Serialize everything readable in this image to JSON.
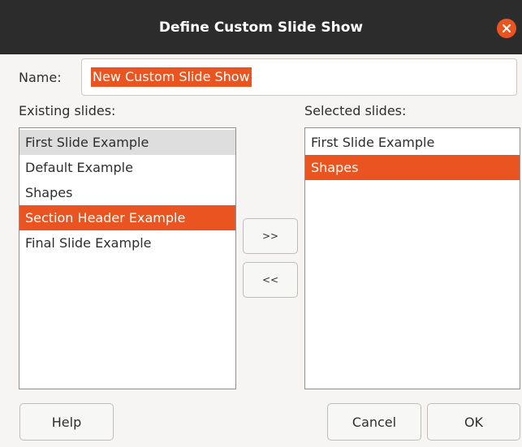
{
  "window": {
    "title": "Define Custom Slide Show",
    "close_icon": "close-icon"
  },
  "name": {
    "label": "Name:",
    "value": "New Custom Slide Show"
  },
  "existing": {
    "label": "Existing slides:",
    "items": [
      {
        "label": "First Slide Example",
        "state": "focused"
      },
      {
        "label": "Default Example",
        "state": "normal"
      },
      {
        "label": "Shapes",
        "state": "normal"
      },
      {
        "label": "Section Header Example",
        "state": "selected"
      },
      {
        "label": "Final Slide Example",
        "state": "normal"
      }
    ]
  },
  "selected": {
    "label": "Selected slides:",
    "items": [
      {
        "label": "First Slide Example",
        "state": "normal"
      },
      {
        "label": "Shapes",
        "state": "selected"
      }
    ]
  },
  "buttons": {
    "add": ">>",
    "remove": "<<",
    "help": "Help",
    "cancel": "Cancel",
    "ok": "OK"
  },
  "colors": {
    "accent": "#e95420",
    "titlebar": "#2c2c2c",
    "background": "#f6f5f4"
  }
}
